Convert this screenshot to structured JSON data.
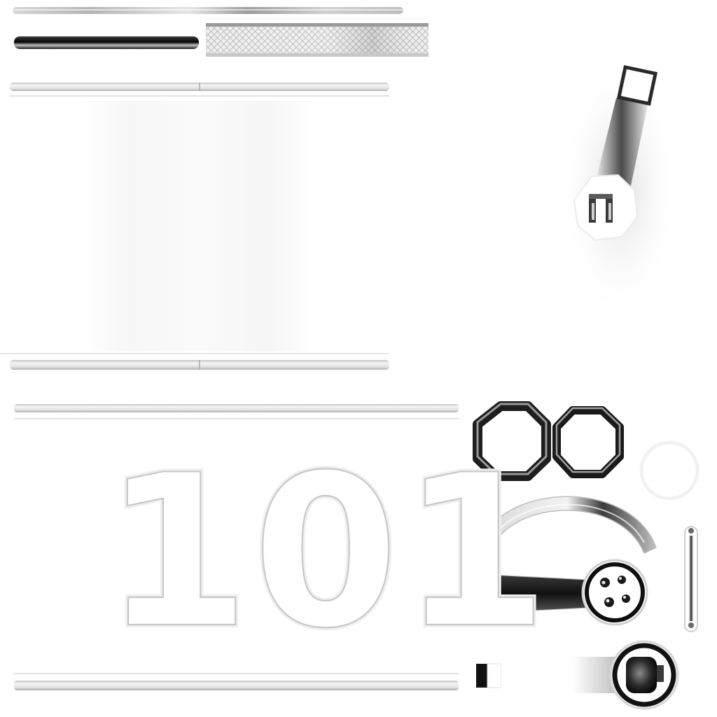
{
  "texture": {
    "number_decal": "101",
    "palette": {
      "background": "#ffffff",
      "dark": "#141414",
      "mid": "#8a8a8a",
      "light": "#dcdcdc",
      "outline": "#c8c8c8"
    },
    "parts": [
      "top-trim-strip",
      "black-rail-bar",
      "diamond-plate-panel",
      "upper-frame-rails",
      "side-panel-area",
      "lower-frame-rails",
      "number-panel",
      "crank-arm",
      "octagon-ring-left",
      "octagon-ring-right",
      "faint-ring",
      "curved-fender",
      "vertical-pin",
      "socket-lever",
      "hub-lever"
    ]
  }
}
